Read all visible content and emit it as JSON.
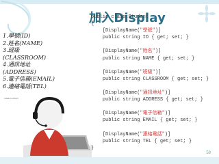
{
  "slide": {
    "title": "加入Display",
    "page_number": "58",
    "caption_small": "FREE.CLIPART",
    "footer_left": "",
    "footer_mid": ""
  },
  "list": [
    "1.學號(ID)",
    "2.姓名(NAME)",
    "3.班級",
    "(CLASSROOM)",
    "4.通訊地址",
    "(ADDRESS)",
    "5.電子信箱(EMAIL)",
    "6.連絡電話(TEL)"
  ],
  "code": {
    "line1": "public class Student",
    "brace_open": "{",
    "blocks": [
      {
        "display_pre": "[DisplayName(",
        "display_str": "\"學號\"",
        "display_post": ")]",
        "prop": "public string ID { get; set; }"
      },
      {
        "display_pre": "[DisplayName(",
        "display_str": "\"姓名\"",
        "display_post": ")]",
        "prop": "public string NAME { get; set; }"
      },
      {
        "display_pre": "[DisplayName(",
        "display_str": "\"班級\"",
        "display_post": ")]",
        "prop": "public string CLASSROOM { get; set; }"
      },
      {
        "display_pre": "[DisplayName(",
        "display_str": "\"通訊地址\"",
        "display_post": ")]",
        "prop": "public string ADDRESS { get; set; }"
      },
      {
        "display_pre": "[DisplayName(",
        "display_str": "\"電子信箱\"",
        "display_post": ")]",
        "prop": "public string EMAIL { get; set; }"
      },
      {
        "display_pre": "[DisplayName(",
        "display_str": "\"連絡電話\"",
        "display_post": ")]",
        "prop": "public string TEL { get; set; }"
      }
    ],
    "brace_close": "}"
  },
  "colors": {
    "title": "#2a6f86",
    "string": "#d23a3a",
    "accent_bar": "#d7ecf4"
  }
}
